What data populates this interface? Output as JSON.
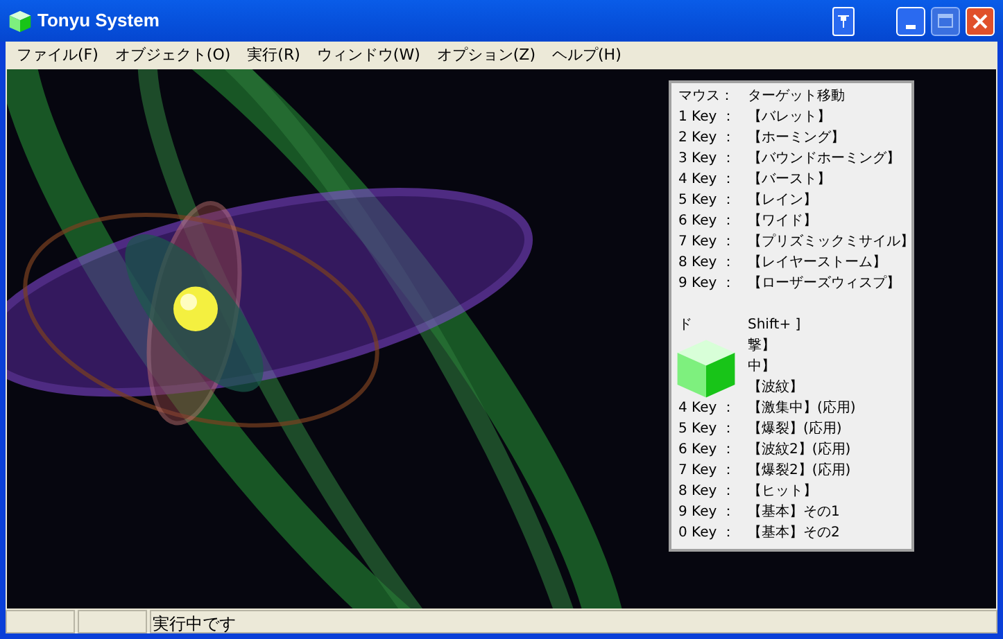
{
  "window": {
    "title": "Tonyu System"
  },
  "menu": [
    {
      "label": "ファイル(F)"
    },
    {
      "label": "オブジェクト(O)"
    },
    {
      "label": "実行(R)"
    },
    {
      "label": "ウィンドウ(W)"
    },
    {
      "label": "オプション(Z)"
    },
    {
      "label": "ヘルプ(H)"
    }
  ],
  "help_panel": {
    "sections": [
      {
        "lines": [
          {
            "key": "マウス：",
            "value": "ターゲット移動"
          },
          {
            "key": "1 Key ：",
            "value": "【バレット】"
          },
          {
            "key": "2 Key ：",
            "value": "【ホーミング】"
          },
          {
            "key": "3 Key ：",
            "value": "【バウンドホーミング】"
          },
          {
            "key": "4 Key ：",
            "value": "【バースト】"
          },
          {
            "key": "5 Key ：",
            "value": "【レイン】"
          },
          {
            "key": "6 Key ：",
            "value": "【ワイド】"
          },
          {
            "key": "7 Key ：",
            "value": "【プリズミックミサイル】"
          },
          {
            "key": "8 Key ：",
            "value": "【レイヤーストーム】"
          },
          {
            "key": "9 Key ：",
            "value": "【ローザーズウィスプ】"
          }
        ]
      },
      {
        "lines": [
          {
            "key": "ド",
            "value": "Shift+ ]"
          },
          {
            "value": "撃】"
          },
          {
            "value": "中】"
          },
          {
            "value": "【波紋】"
          },
          {
            "key": "4 Key ：",
            "value": "【激集中】(応用)"
          },
          {
            "key": "5 Key ：",
            "value": "【爆裂】(応用)"
          },
          {
            "key": "6 Key ：",
            "value": "【波紋2】(応用)"
          },
          {
            "key": "7 Key ：",
            "value": "【爆裂2】(応用)"
          },
          {
            "key": "8 Key ：",
            "value": "【ヒット】"
          },
          {
            "key": "9 Key ：",
            "value": "【基本】その1"
          },
          {
            "key": "0 Key ：",
            "value": "【基本】その2"
          }
        ]
      }
    ]
  },
  "status_bar": {
    "message": "実行中です"
  }
}
